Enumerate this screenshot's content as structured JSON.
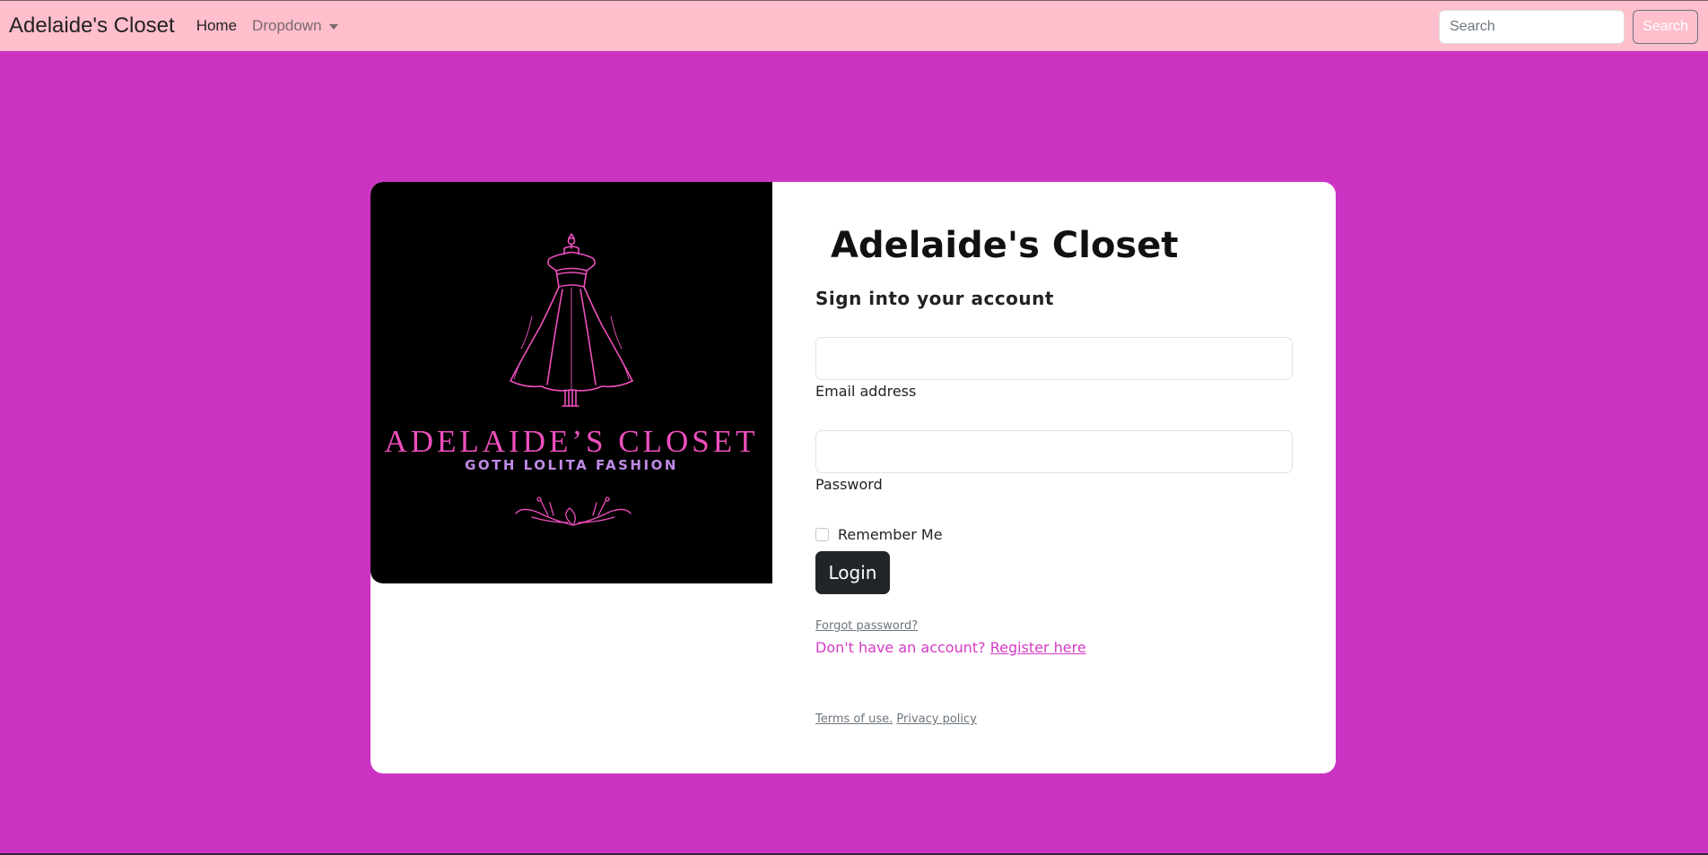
{
  "nav": {
    "brand": "Adelaide's Closet",
    "links": [
      "Home",
      "Dropdown"
    ],
    "search_placeholder": "Search",
    "search_button": "Search"
  },
  "logo": {
    "title": "ADELAIDE’S CLOSET",
    "subtitle": "GOTH LOLITA FASHION"
  },
  "form": {
    "title": "Adelaide's Closet",
    "subtitle": "Sign into your account",
    "email_label": "Email address",
    "email_value": "",
    "password_label": "Password",
    "password_value": "",
    "remember_label": "Remember Me",
    "remember_checked": false,
    "login_button": "Login",
    "forgot_link": "Forgot password?",
    "register_prompt": "Don't have an account? ",
    "register_link": "Register here",
    "terms_link": "Terms of use.",
    "privacy_link": "Privacy policy"
  },
  "colors": {
    "page_background": "#cb34c2",
    "navbar_background": "#ffbfcc",
    "logo_pink": "#ee4fbd",
    "logo_lilac": "#c08ae6",
    "login_button": "#212529"
  }
}
